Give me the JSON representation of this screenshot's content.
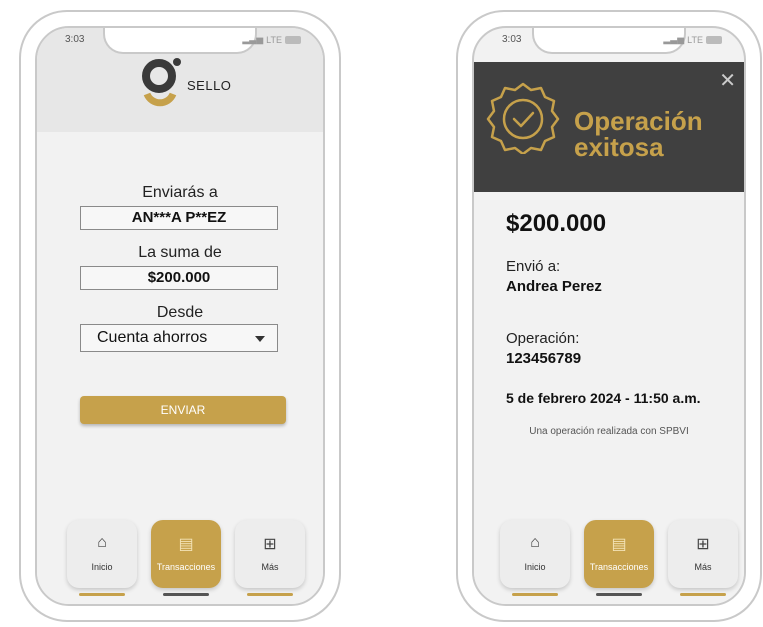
{
  "status": {
    "time": "3:03",
    "network": "LTE"
  },
  "left": {
    "brand": "SELLO",
    "to_label": "Enviarás a",
    "to_value": "AN***A P**EZ",
    "amount_label": "La suma de",
    "amount_value": "$200.000",
    "from_label": "Desde",
    "from_value": "Cuenta ahorros",
    "send_label": "ENVIAR"
  },
  "right": {
    "title_line1": "Operación",
    "title_line2": "exitosa",
    "amount": "$200.000",
    "recipient_label": "Envió a:",
    "recipient_value": "Andrea Perez",
    "operation_label": "Operación:",
    "operation_value": "123456789",
    "date": "5 de febrero 2024 - 11:50 a.m.",
    "note": "Una operación realizada con SPBVI"
  },
  "nav": [
    {
      "label": "Inicio",
      "icon": "home-icon"
    },
    {
      "label": "Transacciones",
      "icon": "money-icon"
    },
    {
      "label": "Más",
      "icon": "grid-icon"
    }
  ],
  "colors": {
    "accent": "#c6a14b",
    "header_dark": "#404040",
    "header_light": "#e7e7e7"
  }
}
